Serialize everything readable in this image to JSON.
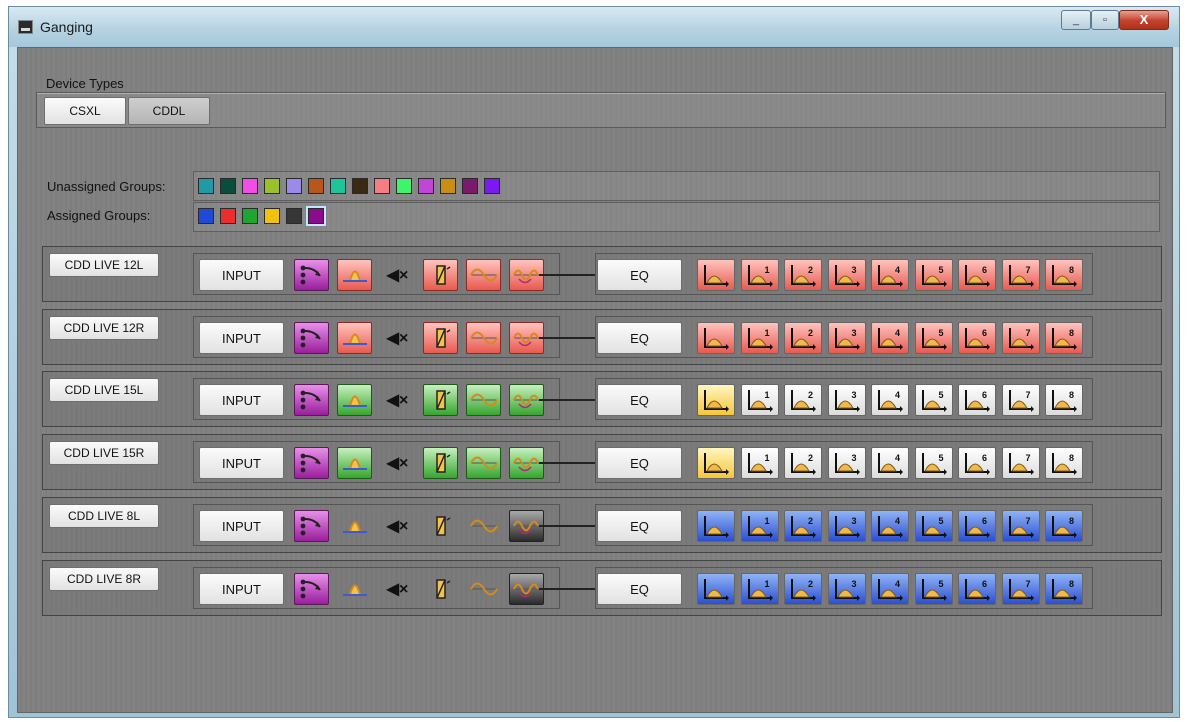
{
  "window": {
    "title": "Ganging",
    "minimize": "_",
    "maximize": "▫",
    "close": "X"
  },
  "device_types": {
    "label": "Device Types",
    "buttons": [
      {
        "label": "CSXL",
        "active": false
      },
      {
        "label": "CDDL",
        "active": true
      }
    ]
  },
  "groups": {
    "unassigned_label": "Unassigned Groups:",
    "assigned_label": "Assigned Groups:",
    "unassigned_colors": [
      "#1f9aa6",
      "#0a4d3d",
      "#f04ee6",
      "#9ac02a",
      "#9b8ae8",
      "#b8561c",
      "#1fc59a",
      "#3a2a12",
      "#f57e84",
      "#3df46a",
      "#c246d6",
      "#c98f14",
      "#7a1a6a",
      "#7a1af0"
    ],
    "assigned_colors": [
      "#1f4ad6",
      "#ea2e2e",
      "#1ea630",
      "#f2c20c",
      "#363636",
      "#8c0a8c"
    ],
    "selected_assigned_index": 5
  },
  "rows": [
    {
      "device": "CDD LIVE 12L",
      "input": "INPUT",
      "eq": "EQ",
      "color": "red",
      "eq_color": "red",
      "first_eq_color": "red",
      "last_icon_dark": false
    },
    {
      "device": "CDD LIVE 12R",
      "input": "INPUT",
      "eq": "EQ",
      "color": "red",
      "eq_color": "red",
      "first_eq_color": "red",
      "last_icon_dark": false
    },
    {
      "device": "CDD LIVE 15L",
      "input": "INPUT",
      "eq": "EQ",
      "color": "green",
      "eq_color": "white",
      "first_eq_color": "yellow",
      "last_icon_dark": false
    },
    {
      "device": "CDD LIVE 15R",
      "input": "INPUT",
      "eq": "EQ",
      "color": "green",
      "eq_color": "white",
      "first_eq_color": "yellow",
      "last_icon_dark": false
    },
    {
      "device": "CDD LIVE 8L",
      "input": "INPUT",
      "eq": "EQ",
      "color": "none",
      "eq_color": "blue",
      "first_eq_color": "blue",
      "last_icon_dark": true
    },
    {
      "device": "CDD LIVE 8R",
      "input": "INPUT",
      "eq": "EQ",
      "color": "none",
      "eq_color": "blue",
      "first_eq_color": "blue",
      "last_icon_dark": true
    }
  ],
  "icons": {
    "route": "routing-icon",
    "delay": "delay-peak-icon",
    "mute": "mute-icon",
    "polarity": "polarity-icon",
    "sine": "sine-icon",
    "filter": "filter-icon",
    "eq_band": "eq-band-icon"
  },
  "eq_band_labels": [
    "",
    "1",
    "2",
    "3",
    "4",
    "5",
    "6",
    "7",
    "8"
  ]
}
